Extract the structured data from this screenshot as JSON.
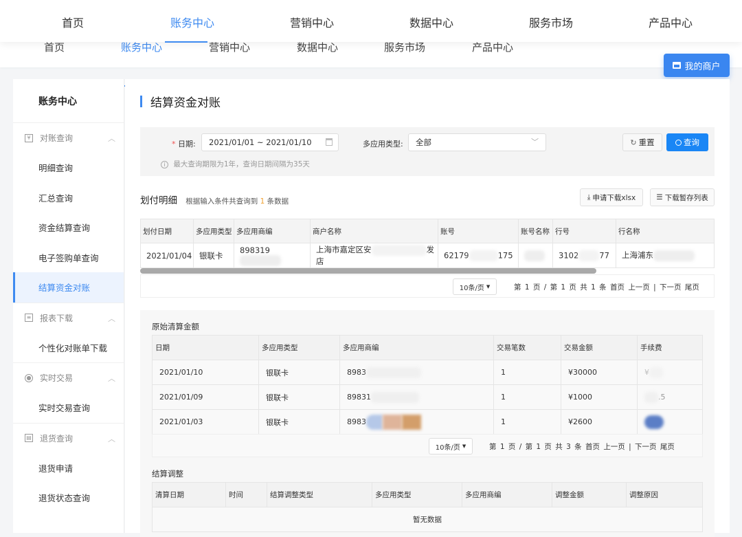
{
  "nav": {
    "items": [
      "首页",
      "账务中心",
      "营销中心",
      "数据中心",
      "服务市场",
      "产品中心"
    ],
    "active_index": 1,
    "my_merchant_label": "我的商户"
  },
  "colors": {
    "accent": "#3e8af0",
    "primary_button": "#1a86f5",
    "required": "#f05050",
    "count_highlight": "#f0a030"
  },
  "sidebar": {
    "title": "账务中心",
    "groups": [
      {
        "label": "对账查询",
        "icon": "receipt-icon",
        "items": [
          "明细查询",
          "汇总查询",
          "资金结算查询",
          "电子签购单查询",
          "结算资金对账"
        ]
      },
      {
        "label": "报表下载",
        "icon": "report-icon",
        "items": [
          "个性化对账单下载"
        ]
      },
      {
        "label": "实时交易",
        "icon": "radio-icon",
        "items": [
          "实时交易查询"
        ]
      },
      {
        "label": "退货查询",
        "icon": "clipboard-icon",
        "items": [
          "退货申请",
          "退货状态查询"
        ]
      }
    ],
    "active_item": "结算资金对账"
  },
  "page": {
    "title": "结算资金对账"
  },
  "filter": {
    "date_label": "日期:",
    "date_required_mark": "*",
    "date_value": "2021/01/01 ~ 2021/01/10",
    "type_label": "多应用类型:",
    "type_value": "全部",
    "hint": "最大查询期限为1年，查询日期间隔为35天",
    "reset_label": "重置",
    "query_label": "查询"
  },
  "payout": {
    "title": "划付明细",
    "subtitle_prefix": "根据输入条件共查询到",
    "count": "1",
    "subtitle_suffix": "条数据",
    "download_xlsx_label": "申请下载xlsx",
    "download_list_label": "下载暂存列表",
    "columns": [
      "划付日期",
      "多应用类型",
      "多应用商编",
      "商户名称",
      "账号",
      "账号名称",
      "行号",
      "行名称"
    ],
    "rows": [
      [
        "2021/01/04",
        "银联卡",
        "898319",
        "上海市嘉定区安",
        "62179",
        "",
        "3102",
        "上海浦东"
      ]
    ],
    "row_tails": [
      [
        "",
        "",
        "",
        "发店",
        "175",
        "",
        "77",
        ""
      ]
    ],
    "pager": {
      "page_size": "10条/页",
      "info": "第 1 页 / 第 1 页 共 1 条",
      "first": "首页",
      "prev": "上一页",
      "sep": "|",
      "next": "下一页",
      "last": "尾页"
    }
  },
  "original": {
    "title": "原始清算金额",
    "columns": [
      "日期",
      "多应用类型",
      "多应用商编",
      "交易笔数",
      "交易金额",
      "手续费"
    ],
    "rows": [
      [
        "2021/01/10",
        "银联卡",
        "8983",
        "1",
        "¥30000",
        "¥"
      ],
      [
        "2021/01/09",
        "银联卡",
        "89831",
        "1",
        "¥1000",
        ".5"
      ],
      [
        "2021/01/03",
        "银联卡",
        "8983",
        "1",
        "¥2600",
        ""
      ]
    ],
    "pager": {
      "page_size": "10条/页",
      "info": "第 1 页 / 第 1 页 共 3 条",
      "first": "首页",
      "prev": "上一页",
      "sep": "|",
      "next": "下一页",
      "last": "尾页"
    }
  },
  "adjust": {
    "title": "结算调整",
    "columns": [
      "清算日期",
      "时间",
      "结算调整类型",
      "多应用类型",
      "多应用商编",
      "调整金额",
      "调整原因"
    ],
    "empty_text": "暂无数据"
  }
}
